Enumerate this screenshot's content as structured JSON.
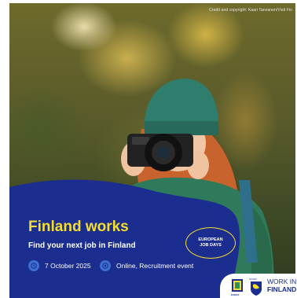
{
  "photo": {
    "credit": "Credit and copyright: Kaari Tanvanen/Visit Fin"
  },
  "banner": {
    "title": "Finland works",
    "subtitle": "Find your next job in Finland",
    "date": "7 October 2025",
    "event_type": "Online, Recruitment event"
  },
  "badge": {
    "line1": "EUROPEAN",
    "line2": "JOB DAYS"
  },
  "logos": {
    "eures_label": "EURES",
    "flag_label": "SUOMI",
    "work_in": "WORK IN",
    "finland": "FINLAND"
  },
  "colors": {
    "panel_blue": "#1b2d8f",
    "accent_yellow": "#f4dd2e",
    "icon_blue": "#3d6fd0"
  }
}
